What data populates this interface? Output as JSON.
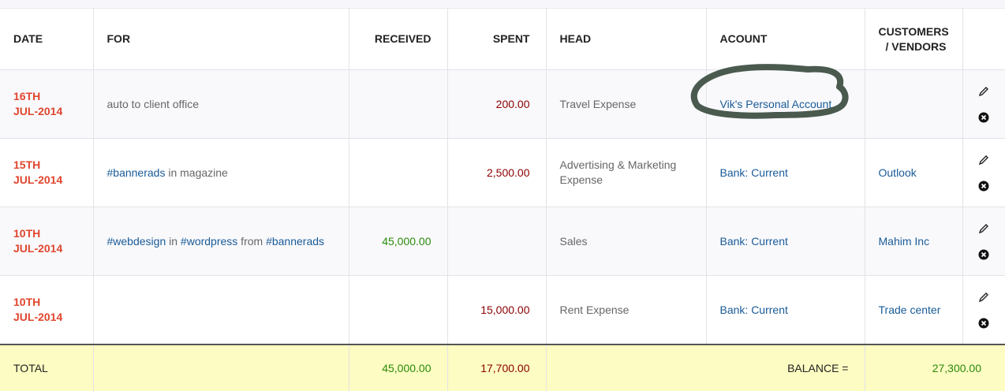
{
  "headers": {
    "date": "DATE",
    "for": "FOR",
    "received": "RECEIVED",
    "spent": "SPENT",
    "head": "HEAD",
    "account": "ACOUNT",
    "customers_line1": "CUSTOMERS",
    "customers_line2": "/ VENDORS"
  },
  "rows": [
    {
      "date_line1": "16TH",
      "date_line2": "JUL-2014",
      "for_text": "auto to client office",
      "received": "",
      "spent": "200.00",
      "head": "Travel Expense",
      "account": "Vik's Personal Account",
      "customer": ""
    },
    {
      "date_line1": "15TH",
      "date_line2": "JUL-2014",
      "for_tag1": "#bannerads",
      "for_text1": " in magazine",
      "received": "",
      "spent": "2,500.00",
      "head": "Advertising & Marketing Expense",
      "account": "Bank: Current",
      "customer": "Outlook"
    },
    {
      "date_line1": "10TH",
      "date_line2": "JUL-2014",
      "for_tag1": "#webdesign",
      "for_text1": " in ",
      "for_tag2": "#wordpress",
      "for_text2": " from ",
      "for_tag3": "#bannerads",
      "received": "45,000.00",
      "spent": "",
      "head": "Sales",
      "account": "Bank: Current",
      "customer": "Mahim Inc"
    },
    {
      "date_line1": "10TH",
      "date_line2": "JUL-2014",
      "for_text": "",
      "received": "",
      "spent": "15,000.00",
      "head": "Rent Expense",
      "account": "Bank: Current",
      "customer": "Trade center"
    }
  ],
  "total": {
    "label": "TOTAL",
    "received": "45,000.00",
    "spent": "17,700.00",
    "balance_label": "BALANCE =",
    "balance": "27,300.00"
  },
  "icons": {
    "edit": "pencil-icon",
    "delete": "close-circle-icon"
  },
  "colors": {
    "date": "#e0462e",
    "link": "#1a5b97",
    "spent": "#8b0000",
    "received": "#2a8a0a",
    "total_bg": "#fdfcc2",
    "annotation": "#4a5a4e"
  }
}
